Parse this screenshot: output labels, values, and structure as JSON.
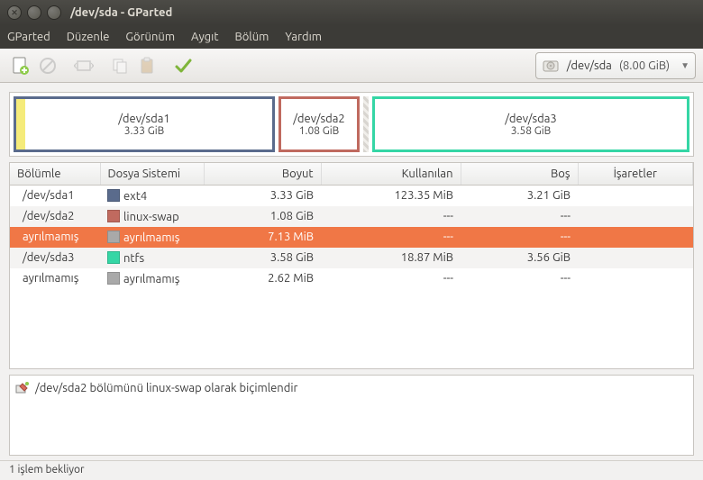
{
  "window": {
    "title": "/dev/sda - GParted"
  },
  "menu": {
    "gparted": "GParted",
    "duzenle": "Düzenle",
    "gorunum": "Görünüm",
    "aygit": "Aygıt",
    "bolum": "Bölüm",
    "yardim": "Yardım"
  },
  "device": {
    "path": "/dev/sda",
    "size": "(8.00 GiB)"
  },
  "graph": {
    "sda1": {
      "name": "/dev/sda1",
      "size": "3.33 GiB"
    },
    "sda2": {
      "name": "/dev/sda2",
      "size": "1.08 GiB"
    },
    "sda3": {
      "name": "/dev/sda3",
      "size": "3.58 GiB"
    }
  },
  "columns": {
    "partition": "Bölümle",
    "filesystem": "Dosya Sistemi",
    "size": "Boyut",
    "used": "Kullanılan",
    "free": "Boş",
    "flags": "İşaretler"
  },
  "rows": [
    {
      "partition": "/dev/sda1",
      "fs": "ext4",
      "swatch": "sw-ext4",
      "size": "3.33 GiB",
      "used": "123.35 MiB",
      "free": "3.21 GiB"
    },
    {
      "partition": "/dev/sda2",
      "fs": "linux-swap",
      "swatch": "sw-swap",
      "size": "1.08 GiB",
      "used": "---",
      "free": "---"
    },
    {
      "partition": "ayrılmamış",
      "fs": "ayrılmamış",
      "swatch": "sw-unalloc",
      "size": "7.13 MiB",
      "used": "---",
      "free": "---"
    },
    {
      "partition": "/dev/sda3",
      "fs": "ntfs",
      "swatch": "sw-ntfs",
      "size": "3.58 GiB",
      "used": "18.87 MiB",
      "free": "3.56 GiB"
    },
    {
      "partition": "ayrılmamış",
      "fs": "ayrılmamış",
      "swatch": "sw-unalloc",
      "size": "2.62 MiB",
      "used": "---",
      "free": "---"
    }
  ],
  "pending": {
    "text": "/dev/sda2 bölümünü linux-swap olarak biçimlendir"
  },
  "status": {
    "text": "1 işlem bekliyor"
  }
}
